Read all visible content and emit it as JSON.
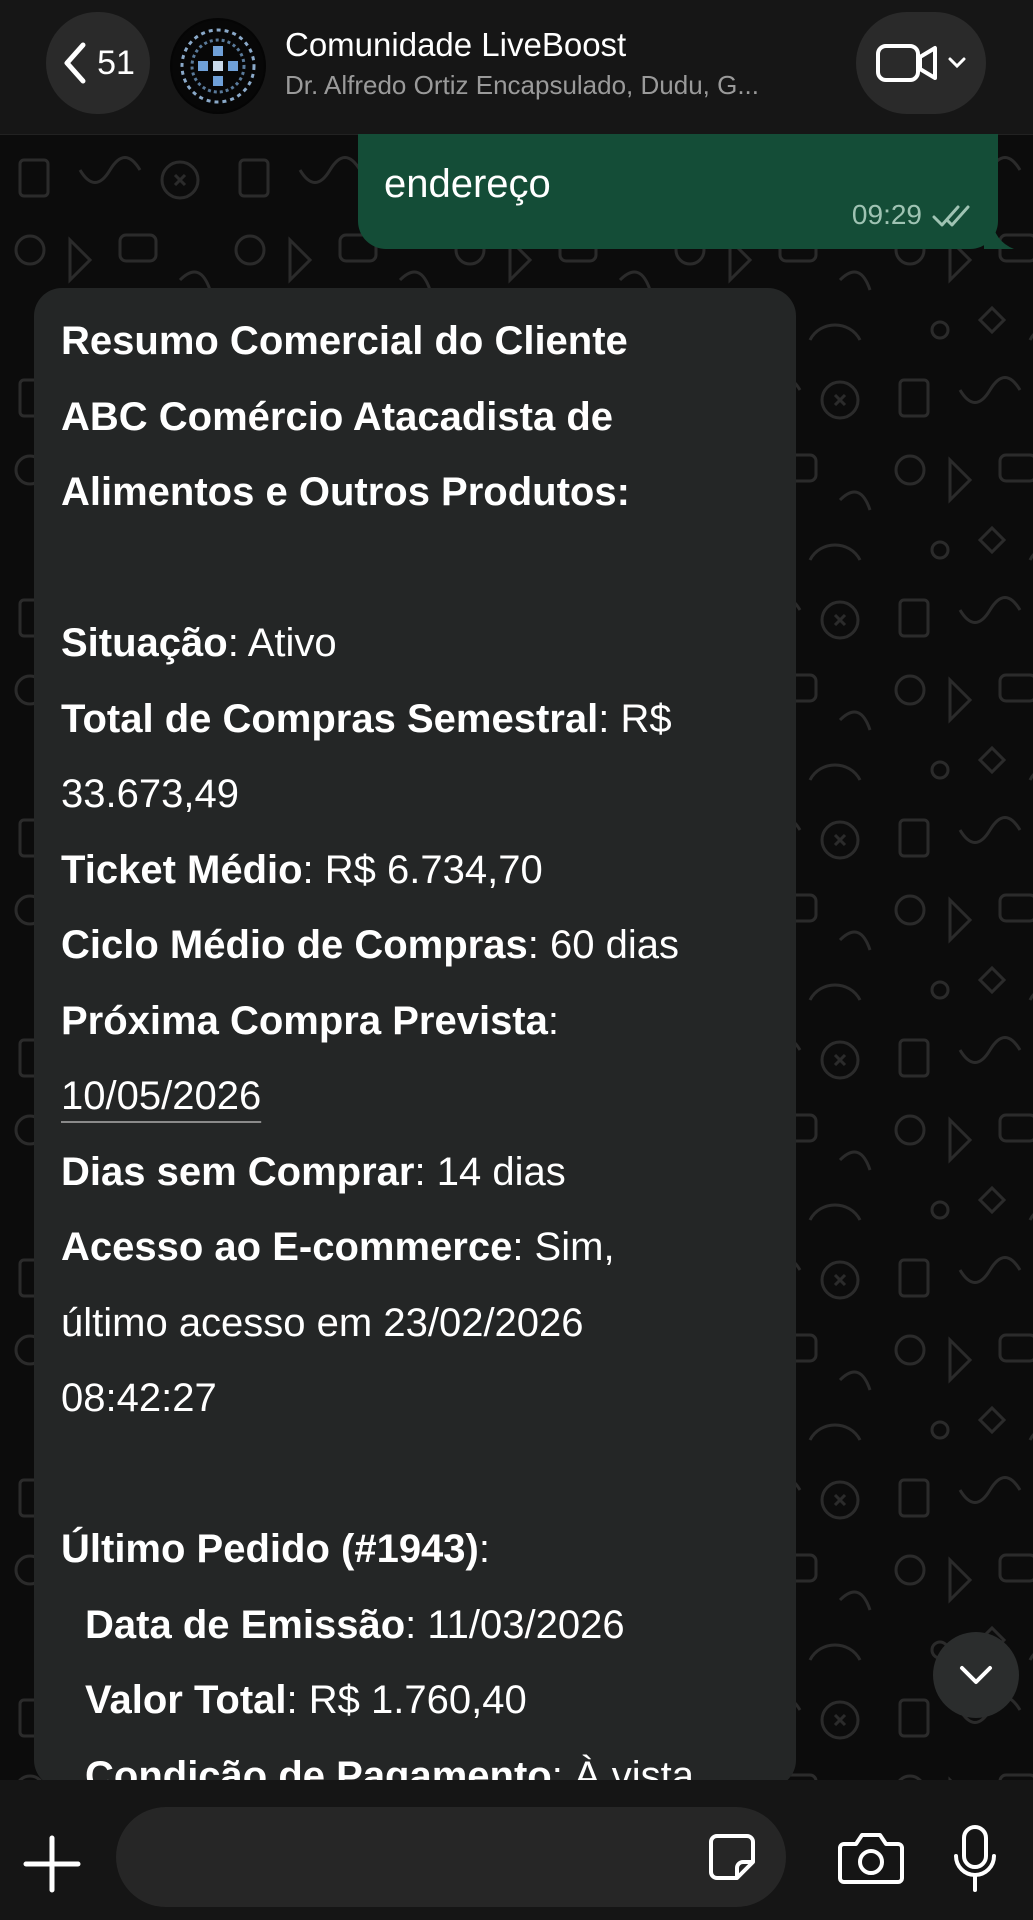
{
  "header": {
    "back_count": "51",
    "chat_title": "Comunidade LiveBoost",
    "chat_subtitle": "Dr. Alfredo Ortiz Encapsulado, Dudu, G..."
  },
  "outgoing": {
    "text": "endereço",
    "time": "09:29"
  },
  "incoming": {
    "lines": [
      {
        "bold": "Resumo Comercial do Cliente",
        "normal": ""
      },
      {
        "bold": "ABC Comércio Atacadista de",
        "normal": ""
      },
      {
        "bold": "Alimentos e Outros Produtos:",
        "normal": ""
      },
      {
        "bold": "",
        "normal": ""
      },
      {
        "bold": "Situação",
        "normal": ": Ativo"
      },
      {
        "bold": "Total de Compras Semestral",
        "normal": ": R$"
      },
      {
        "bold": "",
        "normal": "33.673,49"
      },
      {
        "bold": "Ticket Médio",
        "normal": ": R$ 6.734,70"
      },
      {
        "bold": "Ciclo Médio de Compras",
        "normal": ": 60 dias"
      },
      {
        "bold": "Próxima Compra Prevista",
        "normal": ":"
      },
      {
        "bold": "",
        "link": "10/05/2026"
      },
      {
        "bold": "Dias sem Comprar",
        "normal": ": 14 dias"
      },
      {
        "bold": "Acesso ao E-commerce",
        "normal": ": Sim,"
      },
      {
        "bold": "",
        "normal": "último acesso em 23/02/2026"
      },
      {
        "bold": "",
        "normal": "08:42:27"
      },
      {
        "bold": "",
        "normal": ""
      },
      {
        "bold": "Último Pedido (#1943)",
        "normal": ":"
      },
      {
        "bold": "Data de Emissão",
        "normal": ": 11/03/2026",
        "indent": true
      },
      {
        "bold": "Valor Total",
        "normal": ": R$ 1.760,40",
        "indent": true
      },
      {
        "bold": "Condição de Pagamento",
        "normal": ": À vista",
        "indent": true
      }
    ]
  },
  "icons": {
    "back": "chevron-left-icon",
    "video": "video-camera-icon",
    "scroll": "chevron-down-icon",
    "plus": "plus-icon",
    "sticker": "sticker-icon",
    "camera": "camera-icon",
    "mic": "microphone-icon"
  },
  "colors": {
    "outgoing_bubble": "#144d37",
    "incoming_bubble": "#242626",
    "header_bg": "#161616"
  },
  "composer": {
    "value": ""
  }
}
